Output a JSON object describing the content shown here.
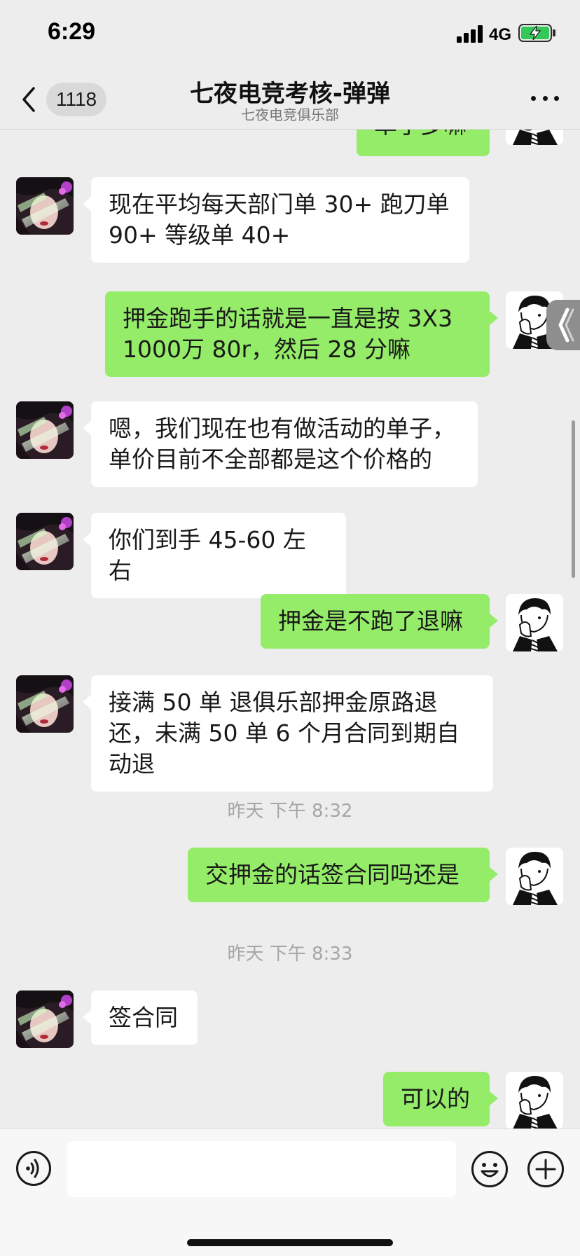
{
  "status_bar": {
    "time": "6:29",
    "network": "4G",
    "battery_color": "#34c759"
  },
  "nav": {
    "back_badge": "1118",
    "title": "七夜电竞考核-弹弹",
    "subtitle": "七夜电竞俱乐部"
  },
  "messages": [
    {
      "side": "right",
      "text": "单子多嘛",
      "partial": true
    },
    {
      "side": "left",
      "text": "现在平均每天部门单 30+ 跑刀单 90+ 等级单 40+"
    },
    {
      "side": "right",
      "text": "押金跑手的话就是一直是按 3X3 1000万 80r，然后 28 分嘛"
    },
    {
      "side": "left",
      "text": "嗯，我们现在也有做活动的单子，单价目前不全部都是这个价格的"
    },
    {
      "side": "left",
      "text": "你们到手 45-60 左右"
    },
    {
      "side": "right",
      "text": "押金是不跑了退嘛"
    },
    {
      "side": "left",
      "text": "接满 50 单 退俱乐部押金原路退还，未满 50 单 6 个月合同到期自动退"
    },
    {
      "type": "time",
      "text": "昨天 下午 8:32"
    },
    {
      "side": "right",
      "text": "交押金的话签合同吗还是"
    },
    {
      "type": "time",
      "text": "昨天 下午 8:33"
    },
    {
      "side": "left",
      "text": "签合同"
    },
    {
      "side": "right",
      "text": "可以的"
    }
  ],
  "input": {
    "placeholder": ""
  },
  "icons": {
    "voice": "voice-icon",
    "emoji": "emoji-icon",
    "plus": "plus-icon",
    "back": "chevron-left-icon",
    "more": "more-icon"
  },
  "colors": {
    "sent_bubble": "#95ec69",
    "received_bubble": "#ffffff",
    "background": "#ededed"
  }
}
